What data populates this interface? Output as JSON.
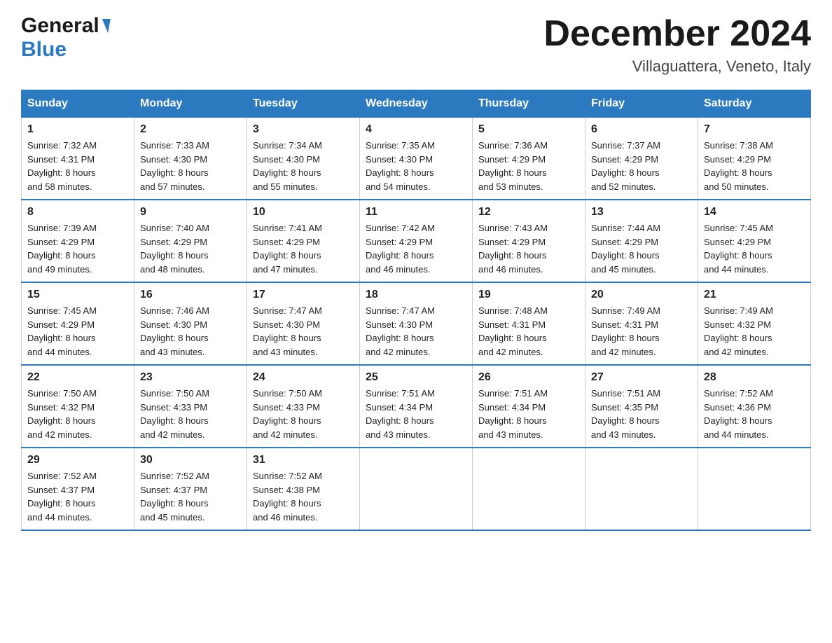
{
  "header": {
    "logo_general": "General",
    "logo_blue": "Blue",
    "month_year": "December 2024",
    "location": "Villaguattera, Veneto, Italy"
  },
  "weekdays": [
    "Sunday",
    "Monday",
    "Tuesday",
    "Wednesday",
    "Thursday",
    "Friday",
    "Saturday"
  ],
  "weeks": [
    [
      {
        "day": "1",
        "sunrise": "7:32 AM",
        "sunset": "4:31 PM",
        "daylight": "8 hours and 58 minutes."
      },
      {
        "day": "2",
        "sunrise": "7:33 AM",
        "sunset": "4:30 PM",
        "daylight": "8 hours and 57 minutes."
      },
      {
        "day": "3",
        "sunrise": "7:34 AM",
        "sunset": "4:30 PM",
        "daylight": "8 hours and 55 minutes."
      },
      {
        "day": "4",
        "sunrise": "7:35 AM",
        "sunset": "4:30 PM",
        "daylight": "8 hours and 54 minutes."
      },
      {
        "day": "5",
        "sunrise": "7:36 AM",
        "sunset": "4:29 PM",
        "daylight": "8 hours and 53 minutes."
      },
      {
        "day": "6",
        "sunrise": "7:37 AM",
        "sunset": "4:29 PM",
        "daylight": "8 hours and 52 minutes."
      },
      {
        "day": "7",
        "sunrise": "7:38 AM",
        "sunset": "4:29 PM",
        "daylight": "8 hours and 50 minutes."
      }
    ],
    [
      {
        "day": "8",
        "sunrise": "7:39 AM",
        "sunset": "4:29 PM",
        "daylight": "8 hours and 49 minutes."
      },
      {
        "day": "9",
        "sunrise": "7:40 AM",
        "sunset": "4:29 PM",
        "daylight": "8 hours and 48 minutes."
      },
      {
        "day": "10",
        "sunrise": "7:41 AM",
        "sunset": "4:29 PM",
        "daylight": "8 hours and 47 minutes."
      },
      {
        "day": "11",
        "sunrise": "7:42 AM",
        "sunset": "4:29 PM",
        "daylight": "8 hours and 46 minutes."
      },
      {
        "day": "12",
        "sunrise": "7:43 AM",
        "sunset": "4:29 PM",
        "daylight": "8 hours and 46 minutes."
      },
      {
        "day": "13",
        "sunrise": "7:44 AM",
        "sunset": "4:29 PM",
        "daylight": "8 hours and 45 minutes."
      },
      {
        "day": "14",
        "sunrise": "7:45 AM",
        "sunset": "4:29 PM",
        "daylight": "8 hours and 44 minutes."
      }
    ],
    [
      {
        "day": "15",
        "sunrise": "7:45 AM",
        "sunset": "4:29 PM",
        "daylight": "8 hours and 44 minutes."
      },
      {
        "day": "16",
        "sunrise": "7:46 AM",
        "sunset": "4:30 PM",
        "daylight": "8 hours and 43 minutes."
      },
      {
        "day": "17",
        "sunrise": "7:47 AM",
        "sunset": "4:30 PM",
        "daylight": "8 hours and 43 minutes."
      },
      {
        "day": "18",
        "sunrise": "7:47 AM",
        "sunset": "4:30 PM",
        "daylight": "8 hours and 42 minutes."
      },
      {
        "day": "19",
        "sunrise": "7:48 AM",
        "sunset": "4:31 PM",
        "daylight": "8 hours and 42 minutes."
      },
      {
        "day": "20",
        "sunrise": "7:49 AM",
        "sunset": "4:31 PM",
        "daylight": "8 hours and 42 minutes."
      },
      {
        "day": "21",
        "sunrise": "7:49 AM",
        "sunset": "4:32 PM",
        "daylight": "8 hours and 42 minutes."
      }
    ],
    [
      {
        "day": "22",
        "sunrise": "7:50 AM",
        "sunset": "4:32 PM",
        "daylight": "8 hours and 42 minutes."
      },
      {
        "day": "23",
        "sunrise": "7:50 AM",
        "sunset": "4:33 PM",
        "daylight": "8 hours and 42 minutes."
      },
      {
        "day": "24",
        "sunrise": "7:50 AM",
        "sunset": "4:33 PM",
        "daylight": "8 hours and 42 minutes."
      },
      {
        "day": "25",
        "sunrise": "7:51 AM",
        "sunset": "4:34 PM",
        "daylight": "8 hours and 43 minutes."
      },
      {
        "day": "26",
        "sunrise": "7:51 AM",
        "sunset": "4:34 PM",
        "daylight": "8 hours and 43 minutes."
      },
      {
        "day": "27",
        "sunrise": "7:51 AM",
        "sunset": "4:35 PM",
        "daylight": "8 hours and 43 minutes."
      },
      {
        "day": "28",
        "sunrise": "7:52 AM",
        "sunset": "4:36 PM",
        "daylight": "8 hours and 44 minutes."
      }
    ],
    [
      {
        "day": "29",
        "sunrise": "7:52 AM",
        "sunset": "4:37 PM",
        "daylight": "8 hours and 44 minutes."
      },
      {
        "day": "30",
        "sunrise": "7:52 AM",
        "sunset": "4:37 PM",
        "daylight": "8 hours and 45 minutes."
      },
      {
        "day": "31",
        "sunrise": "7:52 AM",
        "sunset": "4:38 PM",
        "daylight": "8 hours and 46 minutes."
      },
      null,
      null,
      null,
      null
    ]
  ]
}
